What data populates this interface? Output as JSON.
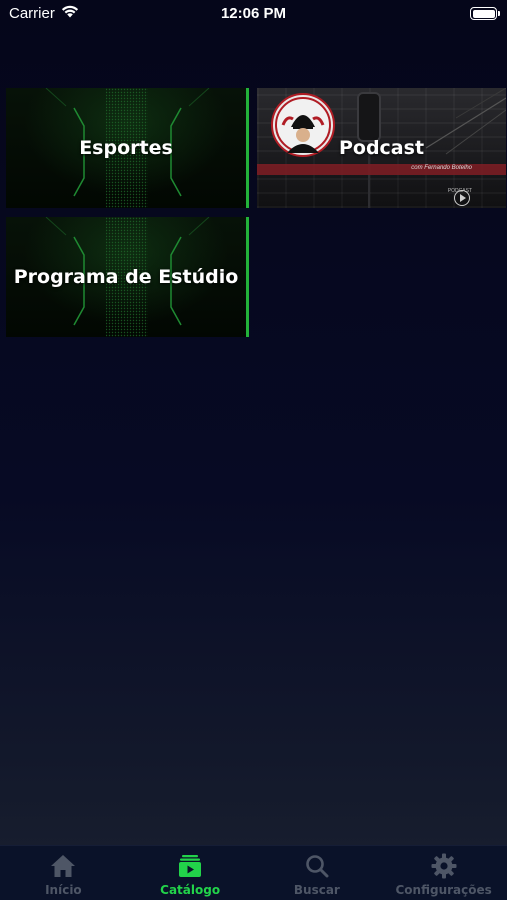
{
  "status_bar": {
    "carrier": "Carrier",
    "time": "12:06 PM"
  },
  "catalog": {
    "categories": [
      {
        "title": "Esportes"
      },
      {
        "title": "Podcast",
        "art_banner_text": "com Fernando Botelho",
        "art_tag_text": "PODCAST"
      },
      {
        "title": "Programa de Estúdio"
      }
    ]
  },
  "tab_bar": {
    "tabs": [
      {
        "label": "Início",
        "icon": "home-icon",
        "active": false
      },
      {
        "label": "Catálogo",
        "icon": "play-folder-icon",
        "active": true
      },
      {
        "label": "Buscar",
        "icon": "search-icon",
        "active": false
      },
      {
        "label": "Configurações",
        "icon": "gear-icon",
        "active": false
      }
    ]
  },
  "colors": {
    "accent": "#22d34a",
    "inactive": "#4e5666",
    "tab_bar_bg": "#0a1229",
    "podcast_banner": "#7a1d24"
  }
}
